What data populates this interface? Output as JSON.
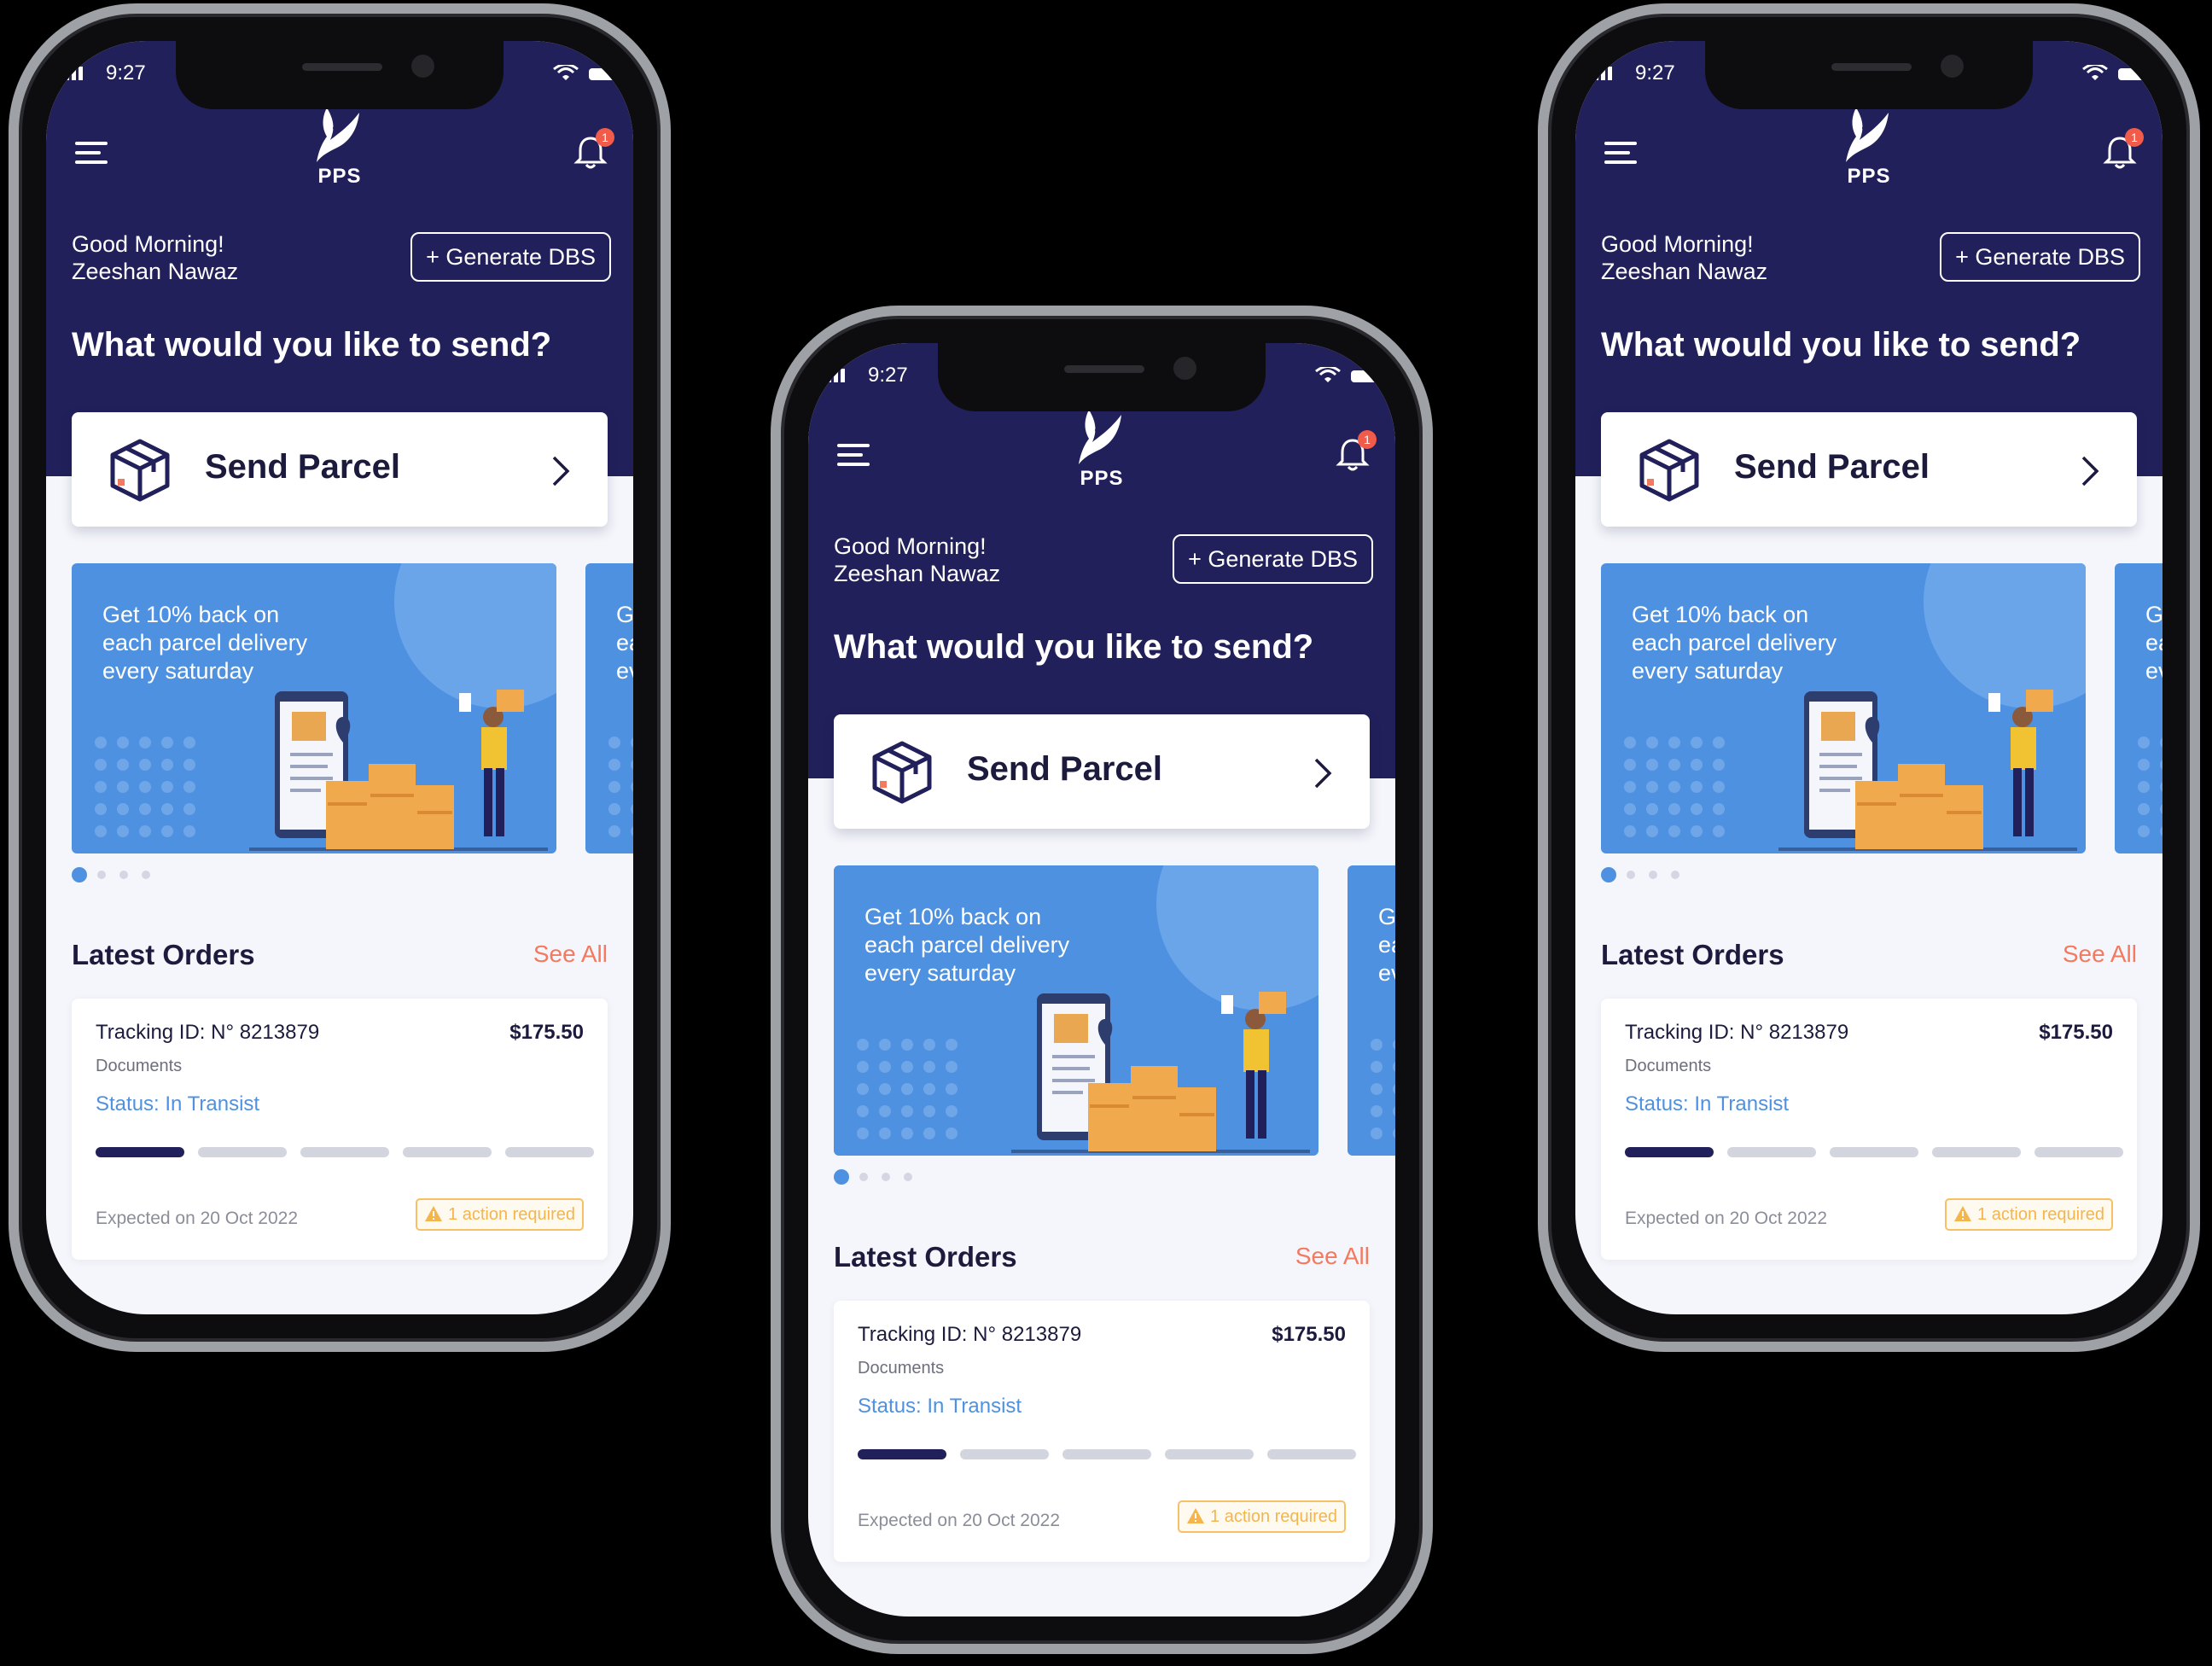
{
  "status_bar": {
    "time": "9:27"
  },
  "app": {
    "logo_text": "PPS",
    "notification_count": "1",
    "greeting_line1": "Good Morning!",
    "greeting_line2": "Zeeshan Nawaz",
    "generate_button": "+ Generate DBS",
    "question": "What would you like to send?",
    "send_card_label": "Send Parcel",
    "banner_text_lines": [
      "Get 10% back on",
      "each parcel delivery",
      "every saturday"
    ],
    "banner_peek_lines": [
      "Ge",
      "ea",
      "ev"
    ],
    "latest_orders_title": "Latest Orders",
    "see_all": "See All",
    "order": {
      "tracking": "Tracking ID: N° 8213879",
      "price": "$175.50",
      "type": "Documents",
      "status": "Status: In Transist",
      "expected": "Expected on 20 Oct 2022",
      "action": "1 action required",
      "progress_step": 1,
      "progress_total": 5
    }
  },
  "colors": {
    "header_bg": "#22205a",
    "accent_blue": "#4e91e1",
    "see_all": "#f3795f",
    "warning": "#f4b54d"
  },
  "icons": [
    "menu-icon",
    "bell-icon",
    "parcel-box-icon",
    "chevron-right-icon",
    "warning-icon",
    "wifi-icon",
    "battery-icon",
    "signal-icon"
  ]
}
